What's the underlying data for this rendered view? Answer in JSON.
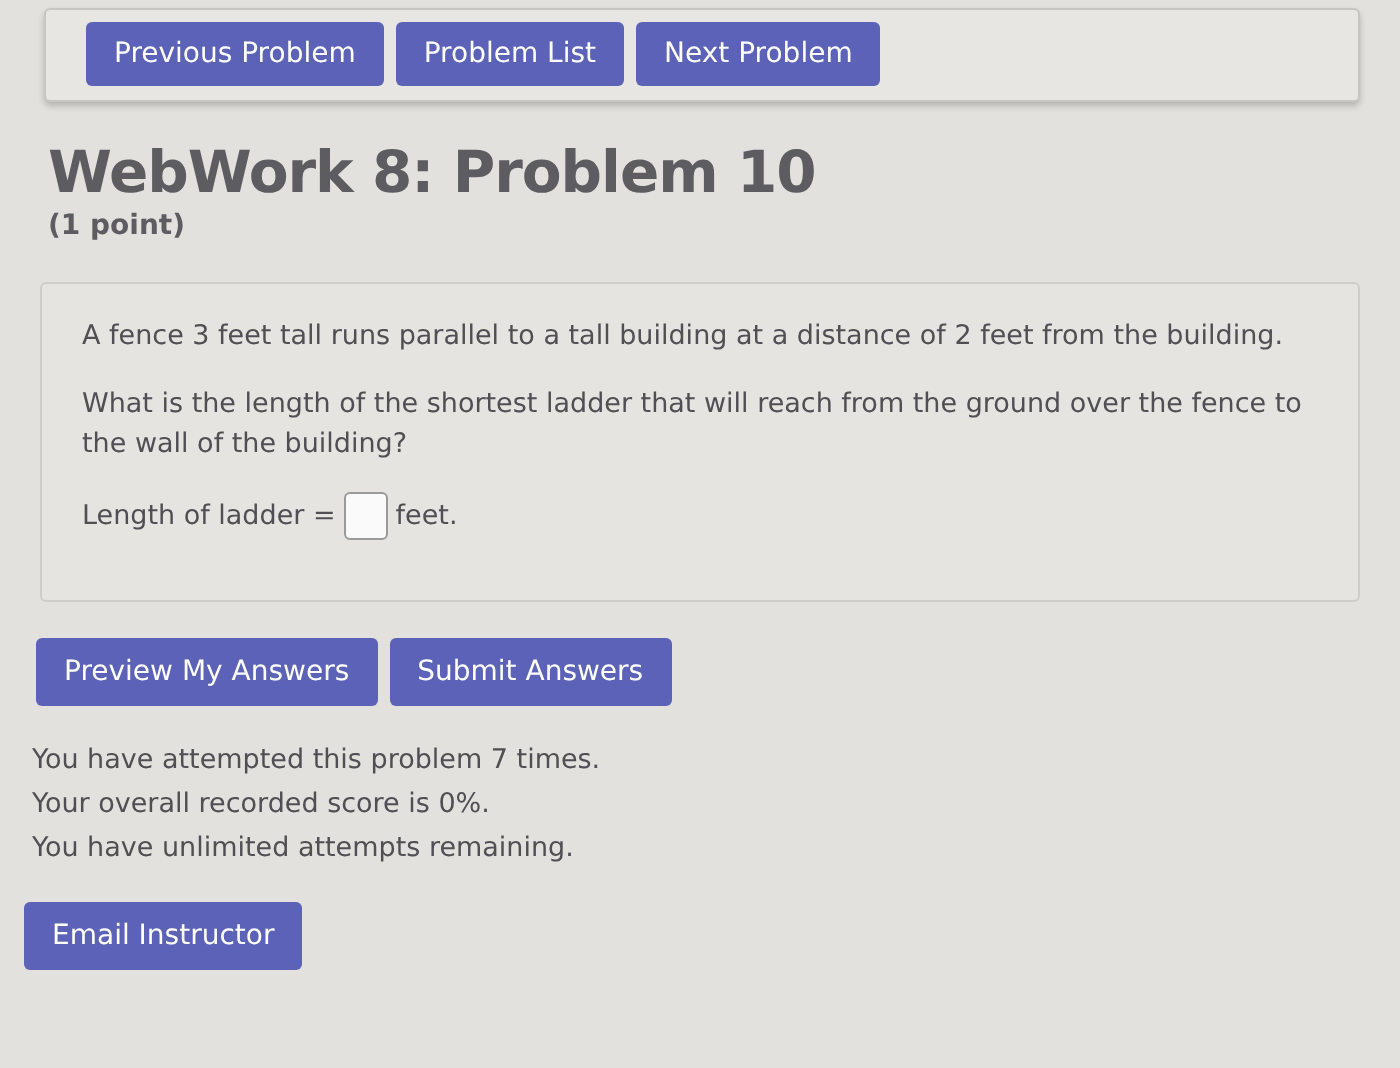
{
  "nav_buttons": [
    "Previous Problem",
    "Problem List",
    "Next Problem"
  ],
  "title": "WebWork 8: Problem 10",
  "points": "(1 point)",
  "problem": {
    "paragraphs": [
      "A fence 3 feet tall runs parallel to a tall building at a distance of 2 feet from the building.",
      "What is the length of the shortest ladder that will reach from the ground over the fence to the wall of the building?"
    ],
    "answer_label": "Length of ladder =",
    "answer_unit": "feet."
  },
  "action_buttons": [
    "Preview My Answers",
    "Submit Answers"
  ],
  "status_lines": [
    "You have attempted this problem 7 times.",
    "Your overall recorded score is 0%.",
    "You have unlimited attempts remaining."
  ],
  "email_button": "Email Instructor"
}
